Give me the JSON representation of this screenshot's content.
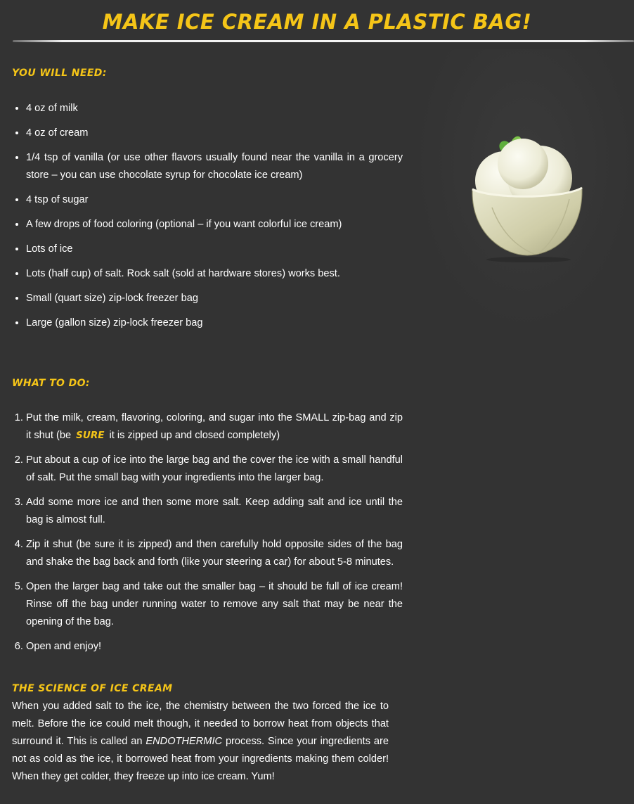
{
  "title": "Make Ice Cream in a Plastic Bag!",
  "needs": {
    "heading": "You Will Need:",
    "items": [
      "4 oz of milk",
      "4 oz of cream",
      "1/4 tsp of vanilla (or use other flavors usually found near the vanilla in a grocery store – you can use chocolate syrup for chocolate ice cream)",
      "4 tsp of sugar",
      "A few drops of food coloring (optional – if you want colorful ice cream)",
      "Lots of ice",
      "Lots (half cup) of salt. Rock salt (sold at hardware stores) works best.",
      "Small (quart size) zip-lock freezer bag",
      "Large (gallon size) zip-lock freezer bag"
    ]
  },
  "steps": {
    "heading": "What to Do:",
    "step1_before": "Put the milk, cream, flavoring, coloring, and sugar into the SMALL zip-bag and zip it shut (be",
    "step1_emphasis": "SURE",
    "step1_after": "it is zipped up and closed completely)",
    "items": [
      "Put about a cup of ice into the large bag and the cover the ice with a small handful of salt. Put the small bag with your ingredients into the larger bag.",
      "Add some more ice and then some more salt. Keep adding salt and ice until the bag is almost full.",
      "Zip it shut (be sure it is zipped) and then carefully hold opposite sides of the bag and shake the bag back and forth (like your steering a car) for about 5-8 minutes.",
      "Open the larger bag and take out the smaller bag – it should be full of ice cream! Rinse off the bag under running water to remove any salt that may be near the opening of the bag.",
      "Open and enjoy!"
    ]
  },
  "science": {
    "heading": "The Science of Ice Cream",
    "text_before": "When you added salt to the ice, the chemistry between the two forced the ice to melt. Before the ice could melt though, it needed to borrow heat from objects that surround it. This is called an",
    "emphasis": "ENDOTHERMIC",
    "text_after": "process. Since your ingredients are not as cold as the ice, it borrowed heat from your ingredients making them colder! When they get colder, they freeze up into ice cream. Yum!"
  },
  "colors": {
    "background": "#333333",
    "heading": "#f5c518",
    "text": "#ffffff"
  },
  "image": {
    "icon": "ice-cream-bowl-icon"
  }
}
